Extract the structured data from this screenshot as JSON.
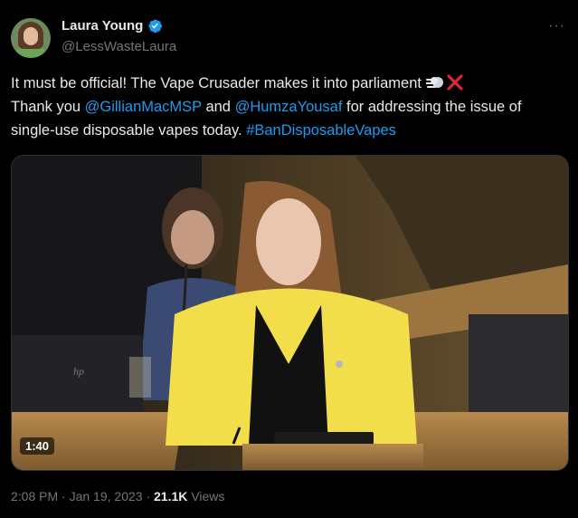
{
  "author": {
    "name": "Laura Young",
    "handle": "@LessWasteLaura",
    "verified_icon": "verified-badge-icon"
  },
  "more_label": "···",
  "tweet": {
    "line1": "It must be official! The Vape Crusader makes it into parliament ",
    "emoji_icons": [
      "dash-icon",
      "cross-mark-icon"
    ],
    "thank": "Thank you ",
    "mention1": "@GillianMacMSP",
    "and": " and ",
    "mention2": "@HumzaYousaf",
    "rest": " for addressing the issue of single-use disposable vapes today. ",
    "hashtag": "#BanDisposableVapes"
  },
  "media": {
    "duration": "1:40",
    "laptop_logo": "hp"
  },
  "meta": {
    "time": "2:08 PM",
    "sep1": " · ",
    "date": "Jan 19, 2023",
    "sep2": " · ",
    "views_count": "21.1K",
    "views_label": " Views"
  },
  "colors": {
    "link": "#1d9bf0",
    "muted": "#71767b",
    "text": "#e7e9ea",
    "background": "#000000"
  }
}
